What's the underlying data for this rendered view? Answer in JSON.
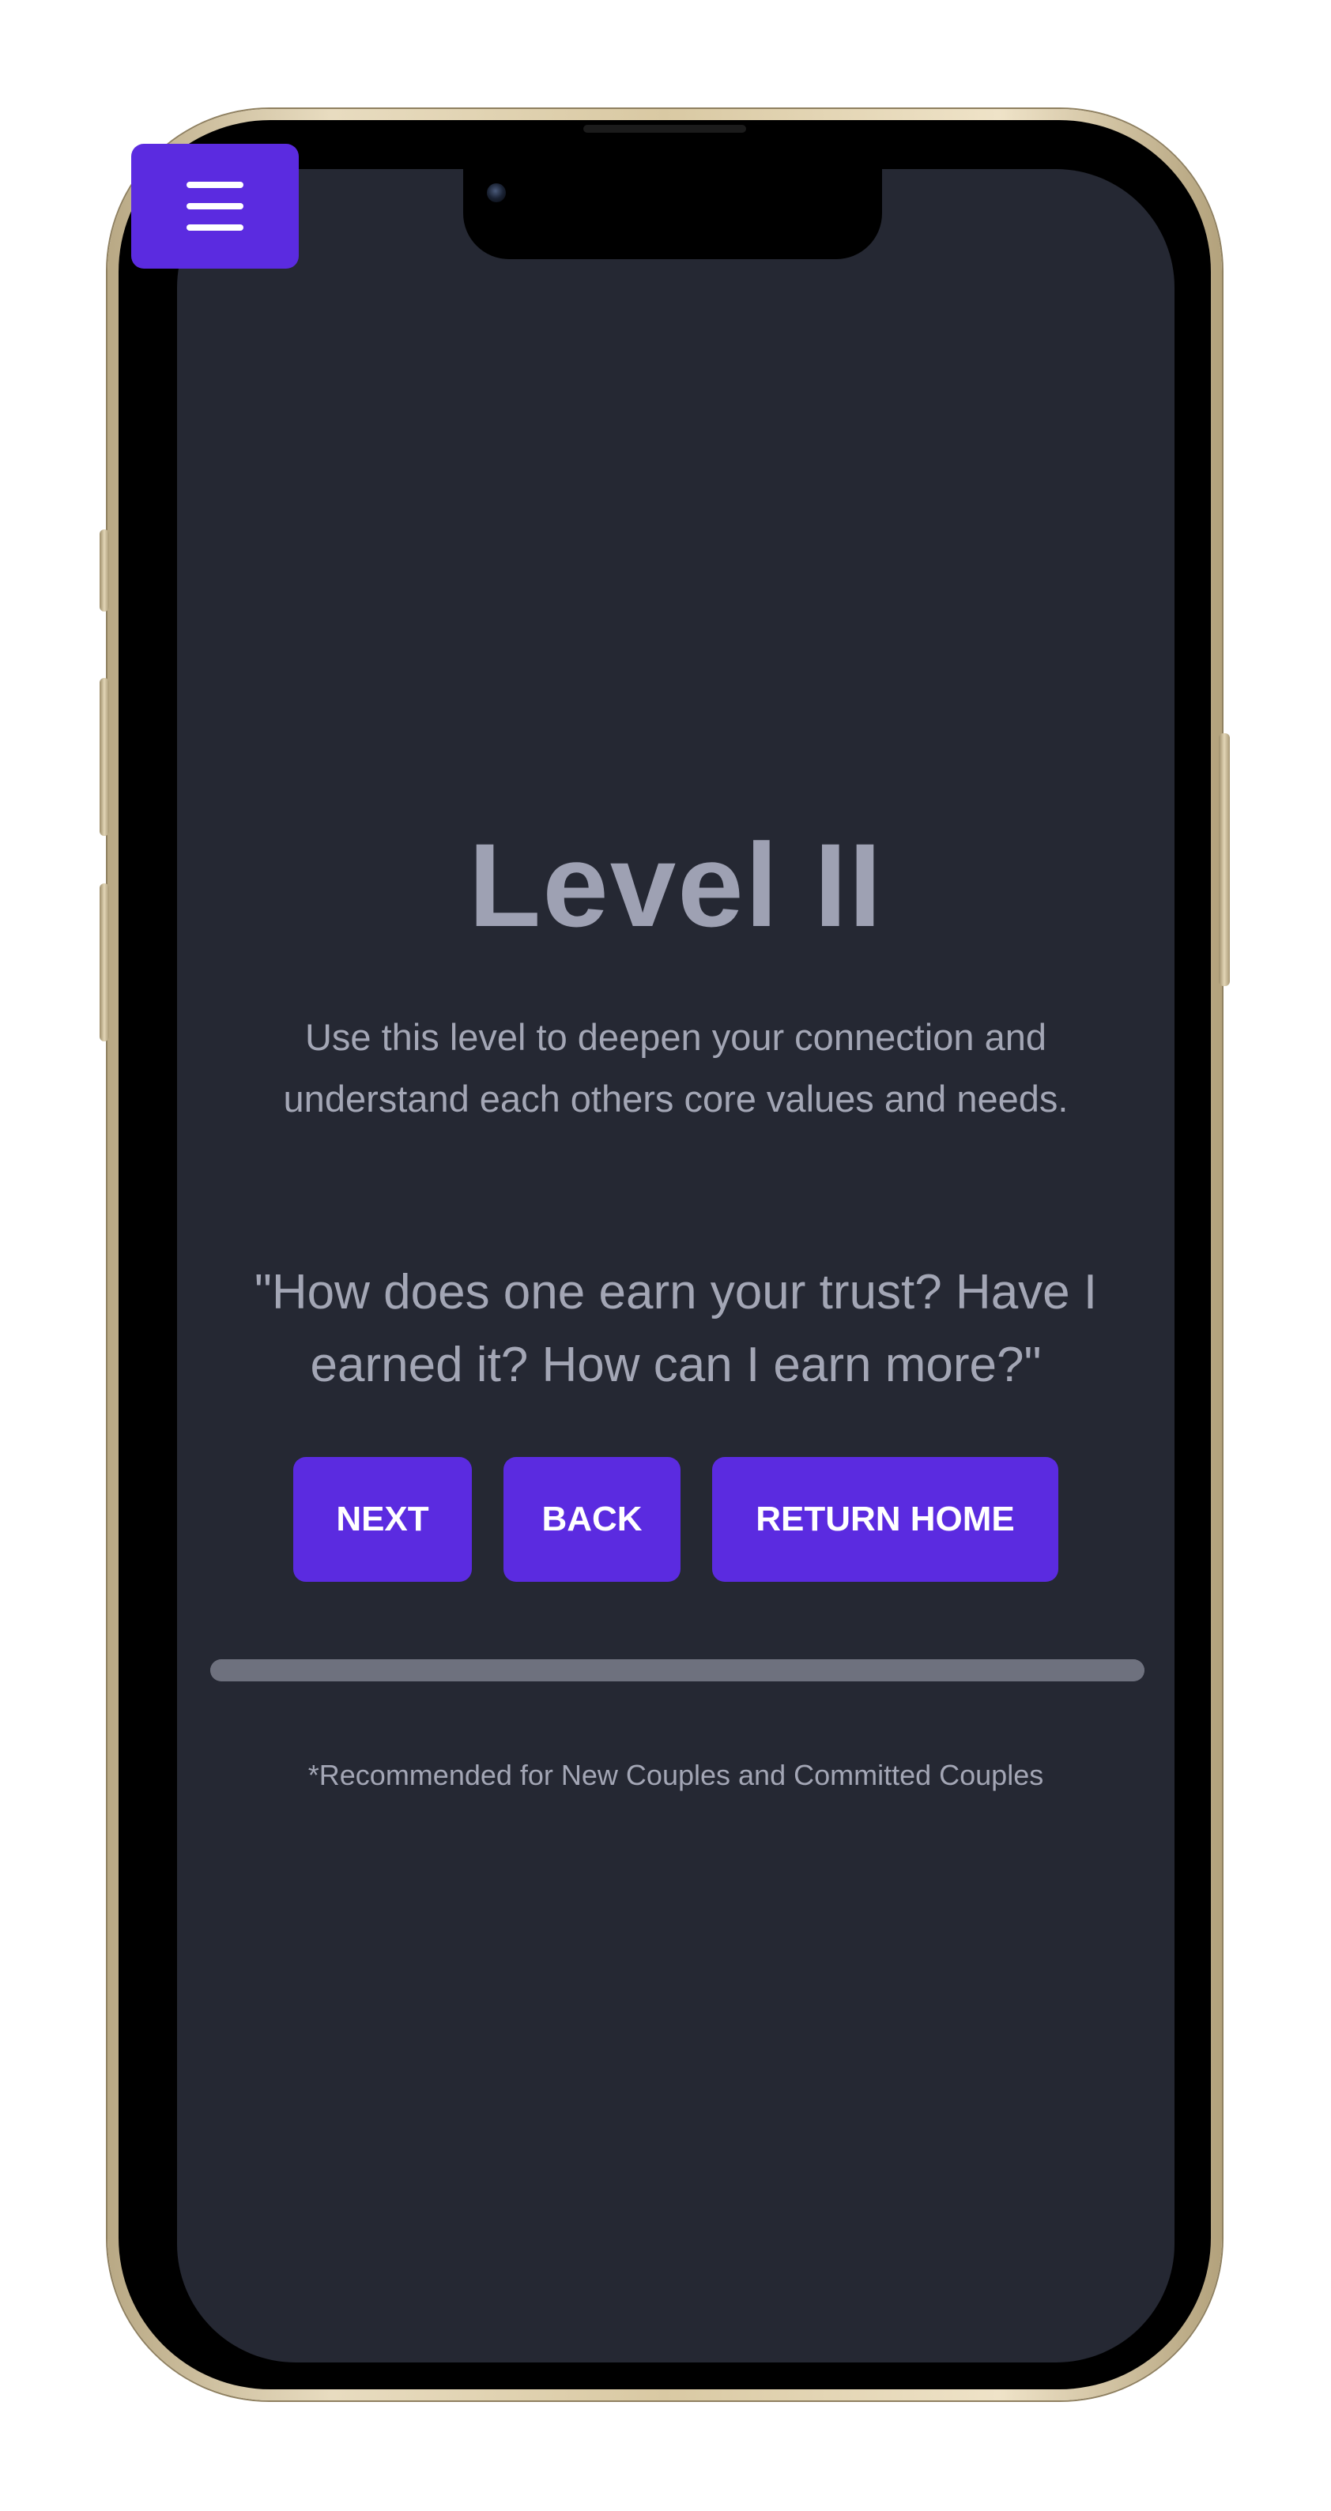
{
  "menu": {
    "icon": "hamburger-menu-icon"
  },
  "level": {
    "title": "Level II",
    "description": "Use this level to deepen your connection and understand each others core values and needs."
  },
  "question": {
    "text": "\"How does one earn your trust? Have I earned it? How can I earn more?\""
  },
  "buttons": {
    "next_label": "NEXT",
    "back_label": "BACK",
    "home_label": "RETURN HOME"
  },
  "progress": {
    "value": 1.0
  },
  "footnote": {
    "text": "*Recommended for New Couples and Committed Couples"
  },
  "colors": {
    "background": "#252833",
    "accent": "#5b2be0",
    "text": "#a3a6b5",
    "title": "#9ea1b3",
    "progress": "#6e717e"
  }
}
